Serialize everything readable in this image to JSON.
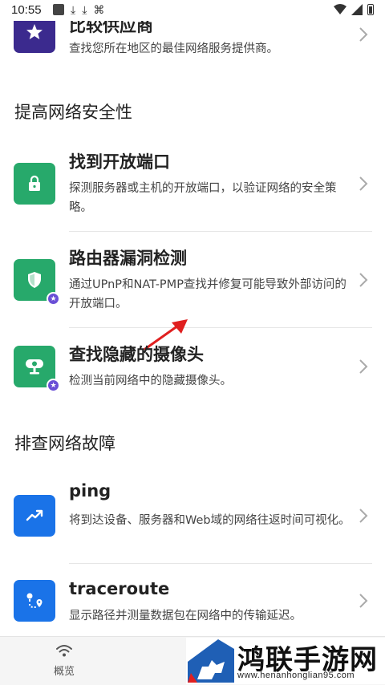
{
  "status_bar": {
    "time": "10:55",
    "icons": [
      "square-icon",
      "download-icon",
      "download-icon",
      "network-glyph-icon",
      "wifi-icon",
      "signal-icon",
      "battery-icon"
    ]
  },
  "sections": {
    "security_title": "提高网络安全性",
    "troubleshoot_title": "排查网络故障"
  },
  "items": [
    {
      "title": "比较供应商",
      "desc": "查找您所在地区的最佳网络服务提供商。",
      "icon": "star-icon"
    },
    {
      "title": "找到开放端口",
      "desc": "探测服务器或主机的开放端口，以验证网络的安全策略。",
      "icon": "lock-icon"
    },
    {
      "title": "路由器漏洞检测",
      "desc": "通过UPnP和NAT-PMP查找并修复可能导致外部访问的开放端口。",
      "icon": "shield-icon"
    },
    {
      "title": "查找隐藏的摄像头",
      "desc": "检测当前网络中的隐藏摄像头。",
      "icon": "camera-icon"
    },
    {
      "title": "ping",
      "desc": "将到达设备、服务器和Web域的网络往返时间可视化。",
      "icon": "trend-icon"
    },
    {
      "title": "traceroute",
      "desc": "显示路径并测量数据包在网络中的传输延迟。",
      "icon": "route-icon"
    }
  ],
  "bottom_nav": {
    "overview_label": "概览"
  },
  "watermark": {
    "brand": "鸿联手游网",
    "url": "www.henanhonglian95.com"
  },
  "colors": {
    "green": "#27a96b",
    "purple": "#3b2a8e",
    "blue": "#1a73e8",
    "badge": "#6a4fd6",
    "arrow": "#e02020"
  }
}
